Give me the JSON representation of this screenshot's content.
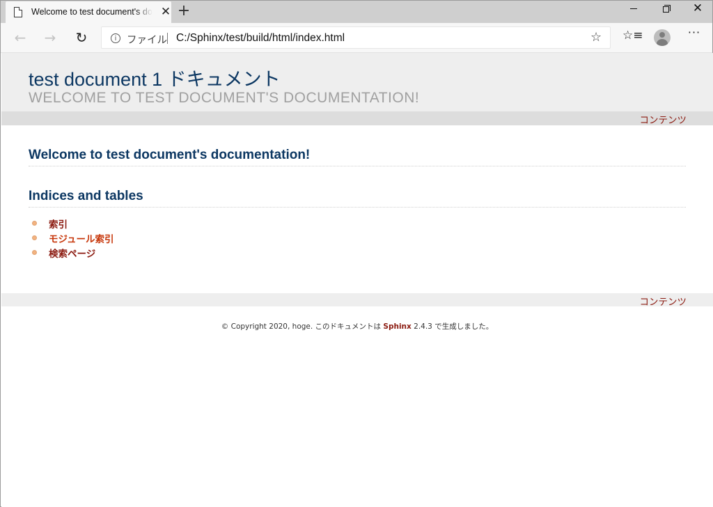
{
  "browser": {
    "tab": {
      "title": "Welcome to test document's documentation!",
      "close_glyph": "✕",
      "icon": "document-icon"
    },
    "new_tab_glyph": "+",
    "window_controls": {
      "close_glyph": "✕"
    },
    "nav": {
      "back_glyph": "←",
      "forward_glyph": "→",
      "reload_glyph": "↻"
    },
    "address": {
      "site_info_glyph": "i",
      "label": "ファイル",
      "url": "C:/Sphinx/test/build/html/index.html"
    },
    "toolbar": {
      "star_glyph": "☆",
      "favorites_glyph": "☆≡",
      "more_glyph": "···"
    }
  },
  "page": {
    "header": {
      "title": "test document 1 ドキュメント",
      "subtitle": "WELCOME TO TEST DOCUMENT'S DOCUMENTATION!"
    },
    "nav_top": {
      "contents_label": "コンテンツ"
    },
    "main": {
      "heading": "Welcome to test document's documentation!",
      "section_heading": "Indices and tables",
      "links": [
        {
          "label": "索引",
          "color": "#8b1a10"
        },
        {
          "label": "モジュール索引",
          "color": "#c7360a"
        },
        {
          "label": "検索ページ",
          "color": "#8b1a10"
        }
      ]
    },
    "nav_bottom": {
      "contents_label": "コンテンツ"
    },
    "footer": {
      "prefix": "© Copyright 2020, hoge. このドキュメントは ",
      "link": "Sphinx",
      "suffix": " 2.4.3 で生成しました。"
    }
  },
  "colors": {
    "title": "#0c3762",
    "link": "#8b1a10",
    "visited_link": "#c7360a",
    "header_bg": "#eeeeee"
  }
}
